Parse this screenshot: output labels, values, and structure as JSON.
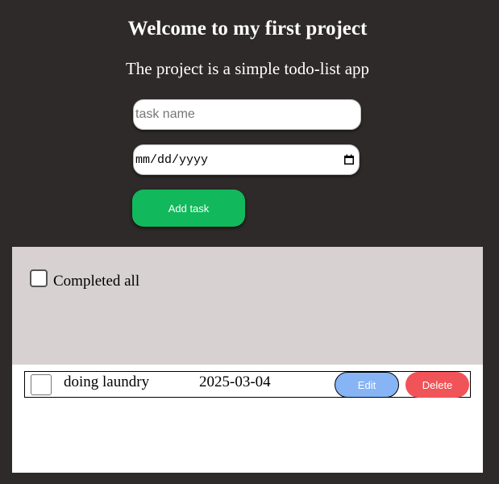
{
  "header": {
    "title": "Welcome to my first project",
    "subtitle": "The project is a simple todo-list app"
  },
  "form": {
    "task_placeholder": "task name",
    "task_value": "",
    "date_placeholder": "mm/dd/yyyy",
    "date_icon": "calendar-icon",
    "add_label": "Add task"
  },
  "completed": {
    "label": "Completed all",
    "checked": false
  },
  "tasks": [
    {
      "name": "doing laundry",
      "date": "2025-03-04",
      "checked": false,
      "edit_label": "Edit",
      "delete_label": "Delete"
    }
  ],
  "colors": {
    "background": "#2e2a29",
    "add_button": "#12b85c",
    "completed_panel": "#d7d1d1",
    "edit_button": "#86b4f5",
    "delete_button": "#f05458"
  }
}
